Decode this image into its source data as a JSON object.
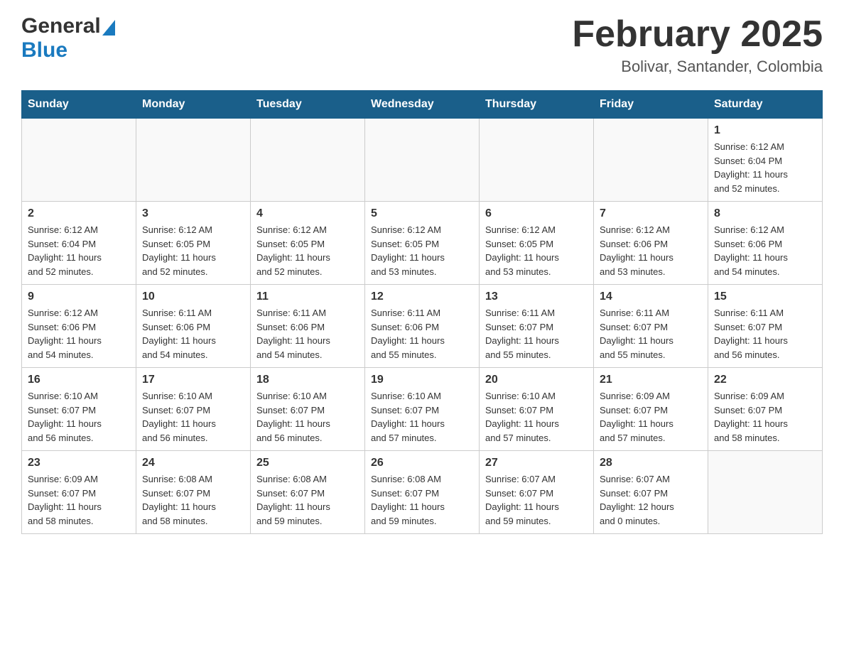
{
  "header": {
    "logo": {
      "general": "General",
      "blue": "Blue",
      "alt": "GeneralBlue logo"
    },
    "title": "February 2025",
    "location": "Bolivar, Santander, Colombia"
  },
  "calendar": {
    "days_of_week": [
      "Sunday",
      "Monday",
      "Tuesday",
      "Wednesday",
      "Thursday",
      "Friday",
      "Saturday"
    ],
    "weeks": [
      {
        "days": [
          {
            "number": "",
            "info": ""
          },
          {
            "number": "",
            "info": ""
          },
          {
            "number": "",
            "info": ""
          },
          {
            "number": "",
            "info": ""
          },
          {
            "number": "",
            "info": ""
          },
          {
            "number": "",
            "info": ""
          },
          {
            "number": "1",
            "info": "Sunrise: 6:12 AM\nSunset: 6:04 PM\nDaylight: 11 hours\nand 52 minutes."
          }
        ]
      },
      {
        "days": [
          {
            "number": "2",
            "info": "Sunrise: 6:12 AM\nSunset: 6:04 PM\nDaylight: 11 hours\nand 52 minutes."
          },
          {
            "number": "3",
            "info": "Sunrise: 6:12 AM\nSunset: 6:05 PM\nDaylight: 11 hours\nand 52 minutes."
          },
          {
            "number": "4",
            "info": "Sunrise: 6:12 AM\nSunset: 6:05 PM\nDaylight: 11 hours\nand 52 minutes."
          },
          {
            "number": "5",
            "info": "Sunrise: 6:12 AM\nSunset: 6:05 PM\nDaylight: 11 hours\nand 53 minutes."
          },
          {
            "number": "6",
            "info": "Sunrise: 6:12 AM\nSunset: 6:05 PM\nDaylight: 11 hours\nand 53 minutes."
          },
          {
            "number": "7",
            "info": "Sunrise: 6:12 AM\nSunset: 6:06 PM\nDaylight: 11 hours\nand 53 minutes."
          },
          {
            "number": "8",
            "info": "Sunrise: 6:12 AM\nSunset: 6:06 PM\nDaylight: 11 hours\nand 54 minutes."
          }
        ]
      },
      {
        "days": [
          {
            "number": "9",
            "info": "Sunrise: 6:12 AM\nSunset: 6:06 PM\nDaylight: 11 hours\nand 54 minutes."
          },
          {
            "number": "10",
            "info": "Sunrise: 6:11 AM\nSunset: 6:06 PM\nDaylight: 11 hours\nand 54 minutes."
          },
          {
            "number": "11",
            "info": "Sunrise: 6:11 AM\nSunset: 6:06 PM\nDaylight: 11 hours\nand 54 minutes."
          },
          {
            "number": "12",
            "info": "Sunrise: 6:11 AM\nSunset: 6:06 PM\nDaylight: 11 hours\nand 55 minutes."
          },
          {
            "number": "13",
            "info": "Sunrise: 6:11 AM\nSunset: 6:07 PM\nDaylight: 11 hours\nand 55 minutes."
          },
          {
            "number": "14",
            "info": "Sunrise: 6:11 AM\nSunset: 6:07 PM\nDaylight: 11 hours\nand 55 minutes."
          },
          {
            "number": "15",
            "info": "Sunrise: 6:11 AM\nSunset: 6:07 PM\nDaylight: 11 hours\nand 56 minutes."
          }
        ]
      },
      {
        "days": [
          {
            "number": "16",
            "info": "Sunrise: 6:10 AM\nSunset: 6:07 PM\nDaylight: 11 hours\nand 56 minutes."
          },
          {
            "number": "17",
            "info": "Sunrise: 6:10 AM\nSunset: 6:07 PM\nDaylight: 11 hours\nand 56 minutes."
          },
          {
            "number": "18",
            "info": "Sunrise: 6:10 AM\nSunset: 6:07 PM\nDaylight: 11 hours\nand 56 minutes."
          },
          {
            "number": "19",
            "info": "Sunrise: 6:10 AM\nSunset: 6:07 PM\nDaylight: 11 hours\nand 57 minutes."
          },
          {
            "number": "20",
            "info": "Sunrise: 6:10 AM\nSunset: 6:07 PM\nDaylight: 11 hours\nand 57 minutes."
          },
          {
            "number": "21",
            "info": "Sunrise: 6:09 AM\nSunset: 6:07 PM\nDaylight: 11 hours\nand 57 minutes."
          },
          {
            "number": "22",
            "info": "Sunrise: 6:09 AM\nSunset: 6:07 PM\nDaylight: 11 hours\nand 58 minutes."
          }
        ]
      },
      {
        "days": [
          {
            "number": "23",
            "info": "Sunrise: 6:09 AM\nSunset: 6:07 PM\nDaylight: 11 hours\nand 58 minutes."
          },
          {
            "number": "24",
            "info": "Sunrise: 6:08 AM\nSunset: 6:07 PM\nDaylight: 11 hours\nand 58 minutes."
          },
          {
            "number": "25",
            "info": "Sunrise: 6:08 AM\nSunset: 6:07 PM\nDaylight: 11 hours\nand 59 minutes."
          },
          {
            "number": "26",
            "info": "Sunrise: 6:08 AM\nSunset: 6:07 PM\nDaylight: 11 hours\nand 59 minutes."
          },
          {
            "number": "27",
            "info": "Sunrise: 6:07 AM\nSunset: 6:07 PM\nDaylight: 11 hours\nand 59 minutes."
          },
          {
            "number": "28",
            "info": "Sunrise: 6:07 AM\nSunset: 6:07 PM\nDaylight: 12 hours\nand 0 minutes."
          },
          {
            "number": "",
            "info": ""
          }
        ]
      }
    ]
  }
}
